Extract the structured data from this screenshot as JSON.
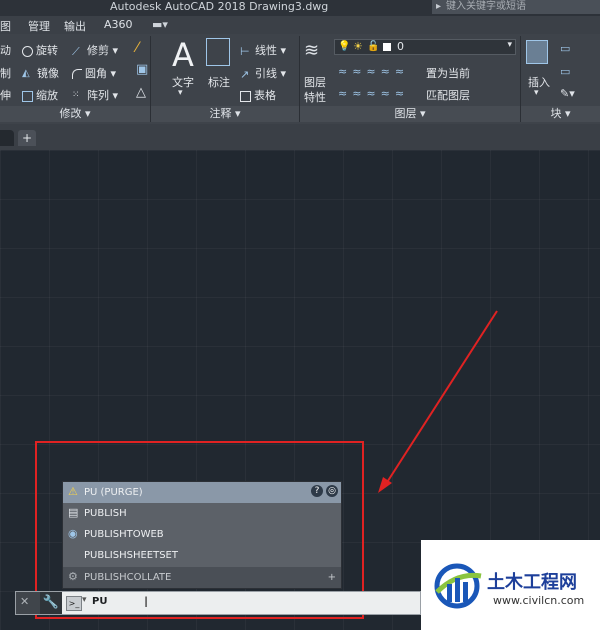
{
  "titlebar": {
    "title": "Autodesk AutoCAD 2018    Drawing3.dwg",
    "search_placeholder": "键入关键字或短语"
  },
  "menubar": {
    "items": [
      "图",
      "管理",
      "输出",
      "A360"
    ]
  },
  "ribbon": {
    "modify": {
      "rotate": "旋转",
      "trim": "修剪",
      "mirror": "镜像",
      "fillet": "圆角",
      "scale": "缩放",
      "array": "阵列",
      "left1": "动",
      "left2": "制",
      "left3": "伸",
      "title": "修改"
    },
    "annotation": {
      "text": "文字",
      "dimension": "标注",
      "linear": "线性",
      "leader": "引线",
      "table": "表格",
      "title": "注释"
    },
    "layers": {
      "properties_line1": "图层",
      "properties_line2": "特性",
      "current_layer": "0",
      "set_current": "置为当前",
      "match_layer": "匹配图层",
      "title": "图层"
    },
    "block": {
      "insert": "插入",
      "title": "块"
    }
  },
  "tabs": {
    "add_label": "+"
  },
  "autocomplete": {
    "items": [
      {
        "label": "PU (PURGE)",
        "icon": "purge-icon"
      },
      {
        "label": "PUBLISH",
        "icon": "publish-icon"
      },
      {
        "label": "PUBLISHTOWEB",
        "icon": "publish-web-icon"
      },
      {
        "label": "PUBLISHSHEETSET",
        "icon": ""
      },
      {
        "label": "PUBLISHCOLLATE",
        "icon": "gear-icon"
      }
    ]
  },
  "command": {
    "input_value": "PU"
  },
  "logo": {
    "name": "土木工程网",
    "url": "www.civilcn.com"
  },
  "colors": {
    "annotation_red": "#e02222",
    "canvas": "#212830",
    "selected": "#8a98a8"
  }
}
